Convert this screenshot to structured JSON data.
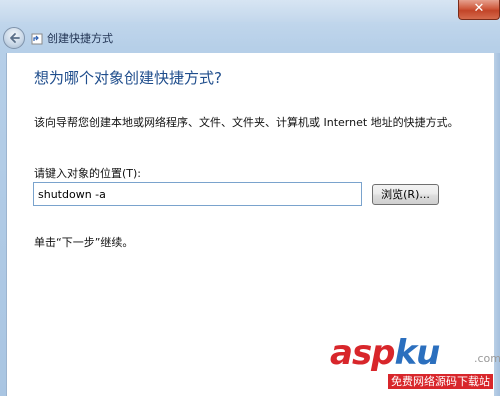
{
  "window": {
    "title": "创建快捷方式",
    "close_label": "✕"
  },
  "wizard": {
    "heading": "想为哪个对象创建快捷方式?",
    "description": "该向导帮您创建本地或网络程序、文件、文件夹、计算机或 Internet 地址的快捷方式。",
    "location_label": "请键入对象的位置(T):",
    "location_value": "shutdown -a",
    "browse_label": "浏览(R)...",
    "hint": "单击“下一步”继续。"
  },
  "watermark": {
    "brand_a": "asp",
    "brand_b": "ku",
    "domain_suffix": ".com",
    "tagline": "免费网络源码下载站"
  },
  "icons": {
    "back": "back-arrow-icon",
    "wizard": "shortcut-wizard-icon"
  },
  "colors": {
    "heading": "#1f4d8c",
    "input_border": "#7aa3cd",
    "frame": "#b6cfe8",
    "watermark_red": "#d8262b",
    "watermark_blue": "#2b6fbe"
  }
}
